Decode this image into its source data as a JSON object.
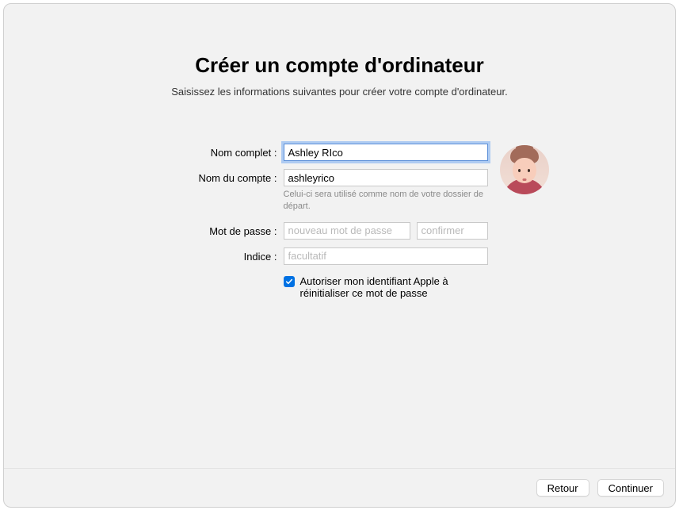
{
  "header": {
    "title": "Créer un compte d'ordinateur",
    "subtitle": "Saisissez les informations suivantes pour créer votre compte d'ordinateur."
  },
  "form": {
    "full_name": {
      "label": "Nom complet :",
      "value": "Ashley RIco"
    },
    "account_name": {
      "label": "Nom du compte :",
      "value": "ashleyrico",
      "helper": "Celui-ci sera utilisé comme nom de votre dossier de départ."
    },
    "password": {
      "label": "Mot de passe :",
      "new_placeholder": "nouveau mot de passe",
      "confirm_placeholder": "confirmer"
    },
    "hint": {
      "label": "Indice :",
      "placeholder": "facultatif"
    },
    "reset_option": {
      "checked": true,
      "text": "Autoriser mon identifiant Apple à réinitialiser ce mot de passe"
    }
  },
  "avatar": {
    "semantic": "user-memoji-avatar"
  },
  "footer": {
    "back_label": "Retour",
    "continue_label": "Continuer"
  }
}
